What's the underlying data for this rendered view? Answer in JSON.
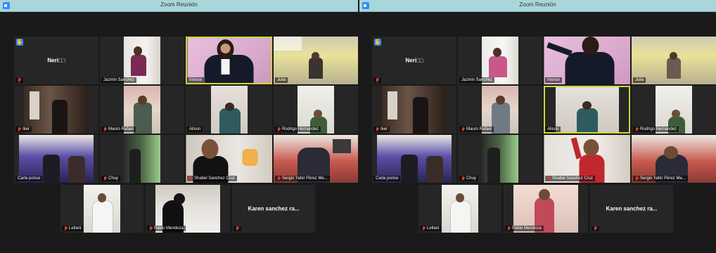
{
  "window_title": "Zoom Reunión",
  "participants": {
    "neri": "Neri□□",
    "jazmin": "Jazmin Sanchez",
    "monse": "monse",
    "julia": "Julia",
    "iker": "Iker",
    "mauro": "Mauro Rafael",
    "alison": "Alison",
    "rodrigo": "Rodrigo Hernandez",
    "carla": "Carla ponce",
    "chuy": "Chuy",
    "shabel": "Shabel Sanchez Cruz",
    "sergio": "Sergio Yahir Pérez Me...",
    "leilani": "Leilani",
    "pablo": "Pablo Mendoza",
    "karen": "Karen sanchez ra..."
  },
  "raise_hand_icon": "✋",
  "colors": {
    "titlebar": "#a9d6da",
    "active_speaker": "#c9d63a",
    "muted": "#e0392f",
    "zoom_blue": "#2d8cff"
  }
}
